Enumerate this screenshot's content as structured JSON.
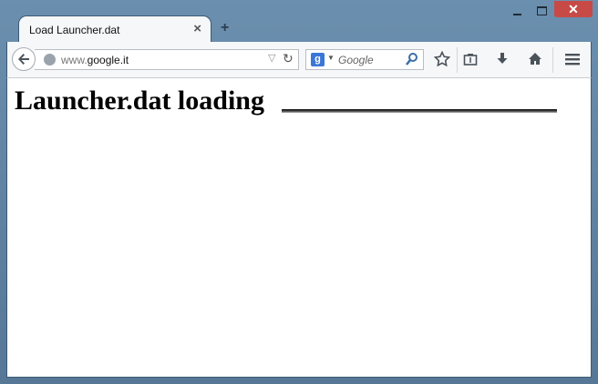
{
  "window": {
    "tab_title": "Load Launcher.dat",
    "tab_close_symbol": "×",
    "new_tab_symbol": "+",
    "close_symbol": "✕"
  },
  "toolbar": {
    "url_prefix": "www.",
    "url_domain": "google.it",
    "search_engine_letter": "g",
    "search_placeholder": "Google",
    "icons": [
      "back-arrow-icon",
      "globe-icon",
      "dropdown-icon",
      "reload-icon",
      "search-icon",
      "bookmark-star-icon",
      "reading-list-icon",
      "download-icon",
      "home-icon",
      "menu-icon"
    ]
  },
  "page": {
    "heading": "Launcher.dat loading"
  },
  "colors": {
    "window_frame": "#5b7d9a",
    "close_button": "#c74a47",
    "search_badge": "#3b77d6"
  }
}
